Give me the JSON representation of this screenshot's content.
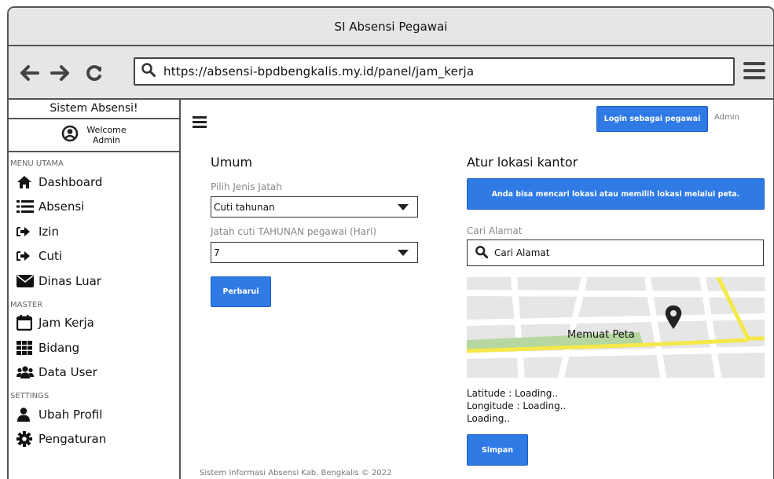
{
  "window": {
    "title": "SI Absensi Pegawai"
  },
  "browser": {
    "url": "https://absensi-bpdbengkalis.my.id/panel/jam_kerja"
  },
  "sidebar": {
    "app_title": "Sistem Absensi!",
    "welcome": "Welcome",
    "user": "Admin",
    "sections": [
      {
        "label": "MENU UTAMA",
        "items": [
          {
            "label": "Dashboard",
            "icon": "home-icon"
          },
          {
            "label": "Absensi",
            "icon": "list-icon"
          },
          {
            "label": "Izin",
            "icon": "sign-in-icon"
          },
          {
            "label": "Cuti",
            "icon": "sign-in-icon"
          },
          {
            "label": "Dinas Luar",
            "icon": "envelope-icon"
          }
        ]
      },
      {
        "label": "MASTER",
        "items": [
          {
            "label": "Jam Kerja",
            "icon": "calendar-icon"
          },
          {
            "label": "Bidang",
            "icon": "grid-icon"
          },
          {
            "label": "Data User",
            "icon": "users-icon"
          }
        ]
      },
      {
        "label": "SETTINGS",
        "items": [
          {
            "label": "Ubah Profil",
            "icon": "user-icon"
          },
          {
            "label": "Pengaturan",
            "icon": "gear-icon"
          }
        ]
      }
    ]
  },
  "header": {
    "login_button": "Login sebagai pegawai",
    "admin_label": "Admin"
  },
  "umum": {
    "title": "Umum",
    "jenis_label": "Pilih Jenis Jatah",
    "jenis_value": "Cuti tahunan",
    "jatah_label": "Jatah cuti TAHUNAN pegawai (Hari)",
    "jatah_value": "7",
    "update_button": "Perbarui"
  },
  "lokasi": {
    "title": "Atur lokasi kantor",
    "info": "Anda bisa mencari lokasi atau memilih lokasi melalui peta.",
    "search_label": "Cari Alamat",
    "search_placeholder": "Cari Alamat",
    "map_label": "Memuat Peta",
    "latitude": "Latitude : Loading..",
    "longitude": "Longitude : Loading..",
    "loading": "Loading..",
    "save_button": "Simpan"
  },
  "footer": "Sistem Informasi Absensi Kab. Bengkalis © 2022",
  "colors": {
    "accent": "#2f7ae5",
    "map_park": "#b6d7a0",
    "map_road": "#f5e84a"
  }
}
